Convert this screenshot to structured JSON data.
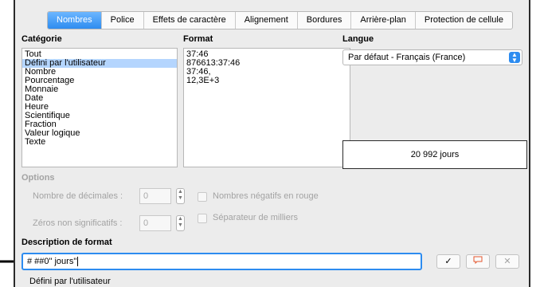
{
  "tabs": [
    "Nombres",
    "Police",
    "Effets de caractère",
    "Alignement",
    "Bordures",
    "Arrière-plan",
    "Protection de cellule"
  ],
  "category": {
    "title": "Catégorie",
    "items": [
      "Tout",
      "Défini par l'utilisateur",
      "Nombre",
      "Pourcentage",
      "Monnaie",
      "Date",
      "Heure",
      "Scientifique",
      "Fraction",
      "Valeur logique",
      "Texte"
    ],
    "selected_index": 1
  },
  "format": {
    "title": "Format",
    "items": [
      "37:46",
      "876613:37:46",
      "37:46,",
      "12,3E+3"
    ]
  },
  "language": {
    "title": "Langue",
    "value": "Par défaut - Français (France)"
  },
  "preview": {
    "text": "20 992 jours"
  },
  "options": {
    "title": "Options",
    "decimals_label": "Nombre de décimales :",
    "decimals_value": "0",
    "negative_red_label": "Nombres négatifs en rouge",
    "leading_zeros_label": "Zéros non significatifs :",
    "leading_zeros_value": "0",
    "thousands_sep_label": "Séparateur de milliers"
  },
  "format_code": {
    "title": "Description de format",
    "value": "# ##0\" jours\""
  },
  "status_text": "Défini par l'utilisateur",
  "buttons": {
    "accept_icon": "checkmark-icon",
    "comment_icon": "comment-icon",
    "delete_icon": "delete-x-icon"
  }
}
